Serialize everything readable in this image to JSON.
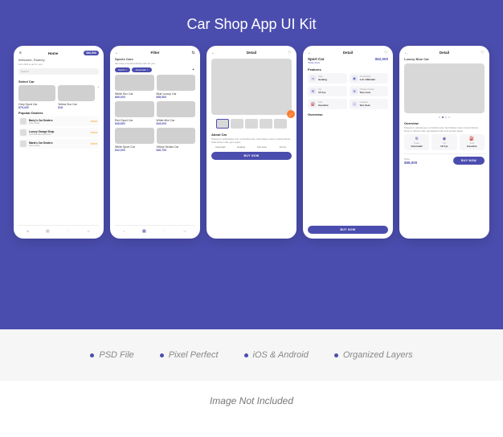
{
  "hero_title": "Car Shop App UI Kit",
  "screens": {
    "home": {
      "title": "Home",
      "balance": "$40,500",
      "welcome": "Welcome, Rodney",
      "tagline": "Let's find a car for you.",
      "search_placeholder": "Search",
      "select_car": "Select Car",
      "cars": [
        {
          "name": "Grey Sport Car",
          "price": "$75,400"
        },
        {
          "name": "Yellow Suv Car",
          "price": "$18"
        }
      ],
      "popular_dealers": "Popular Dealers",
      "dealers": [
        {
          "name": "Barry's Car Dealers",
          "hint": "Open today"
        },
        {
          "name": "Luxury Garage Shop",
          "hint": "Club Member Discounts"
        },
        {
          "name": "Maria's Car Dealers",
          "hint": "Open today"
        }
      ]
    },
    "filter": {
      "title": "Filter",
      "heading": "Sports Cars",
      "sub": "We have compiled all the cars for you.",
      "chips": [
        "Sports",
        "Automatic"
      ],
      "cars": [
        {
          "name": "White Suv Car",
          "price": "$65,000"
        },
        {
          "name": "Blue Luxury Car",
          "price": "$55,500"
        },
        {
          "name": "Red Sport Car",
          "price": "$45,800"
        },
        {
          "name": "White Mini Car",
          "price": "$43,000"
        },
        {
          "name": "White Sport Car",
          "price": "$42,000"
        },
        {
          "name": "Yellow Sedan Car",
          "price": "$40,700"
        }
      ]
    },
    "detail1": {
      "title": "Detail",
      "about": "About Car",
      "desc": "Praesent in pellentesque erat, vel tincidunt ante. Sed tristique metus in lacinia lobortis. Nulla ultrices nulla, eget magna.",
      "specs": [
        "Automatic",
        "Heating",
        "Two-zone",
        "12 Cyl"
      ],
      "cta": "BUY NOW"
    },
    "detail2": {
      "title": "Detail",
      "name": "Sport Car",
      "price": "$62,000",
      "testdrive": "Testle drive",
      "features_label": "Features",
      "feats": [
        {
          "label": "Seat",
          "value": "Heating"
        },
        {
          "label": "Acceleration",
          "value": "1.2s 100km/hr"
        },
        {
          "label": "Cyl",
          "value": "12 Cyl."
        },
        {
          "label": "Climate Control",
          "value": "Two-zone"
        },
        {
          "label": "Fuel",
          "value": "Gasoline"
        },
        {
          "label": "Capacity",
          "value": "Two Seat"
        }
      ],
      "overview": "Overview:",
      "cta": "BUY NOW"
    },
    "detail3": {
      "title": "Detail",
      "name": "Luxury Blue Car",
      "overview": "Overview",
      "desc": "Praesent in vehicula erat, vel tincidunt ante. Sed tristique metus in lacus lobortis. Donec in ultricies nulla, eget placerat nulla amet gravida magna.",
      "feats": [
        {
          "label": "Trans.",
          "value": "Automatic"
        },
        {
          "label": "Cyl",
          "value": "12 Cyl."
        },
        {
          "label": "Fuel",
          "value": "Gasoline"
        }
      ],
      "price_label": "Price",
      "price": "$68,000",
      "cta": "BUY NOW"
    }
  },
  "marketing_bullets": [
    "PSD File",
    "Pixel Perfect",
    "iOS & Android",
    "Organized Layers"
  ],
  "footer_note": "Image Not Included"
}
